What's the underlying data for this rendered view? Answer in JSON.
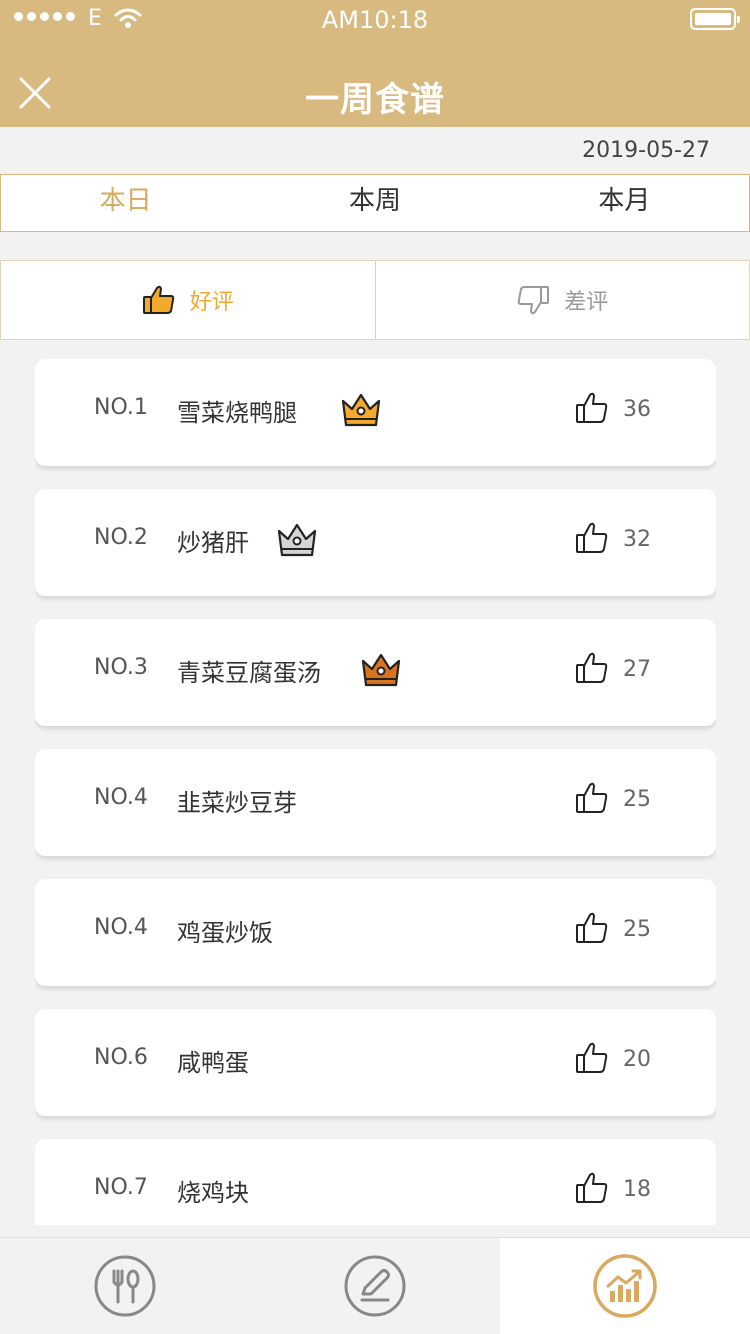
{
  "status_bar": {
    "carrier": "E",
    "time": "AM10:18"
  },
  "header": {
    "title": "一周食谱"
  },
  "date": "2019-05-27",
  "period_tabs": [
    {
      "label": "本日",
      "active": true
    },
    {
      "label": "本周",
      "active": false
    },
    {
      "label": "本月",
      "active": false
    }
  ],
  "rating_tabs": {
    "good": {
      "label": "好评",
      "icon": "thumbs-up-icon",
      "active": true
    },
    "bad": {
      "label": "差评",
      "icon": "thumbs-down-icon",
      "active": false
    }
  },
  "dishes": [
    {
      "rank": "NO.1",
      "name": "雪菜烧鸭腿",
      "crown": "gold",
      "likes": "36"
    },
    {
      "rank": "NO.2",
      "name": "炒猪肝",
      "crown": "silver",
      "likes": "32"
    },
    {
      "rank": "NO.3",
      "name": "青菜豆腐蛋汤",
      "crown": "bronze",
      "likes": "27"
    },
    {
      "rank": "NO.4",
      "name": "韭菜炒豆芽",
      "crown": null,
      "likes": "25"
    },
    {
      "rank": "NO.4",
      "name": "鸡蛋炒饭",
      "crown": null,
      "likes": "25"
    },
    {
      "rank": "NO.6",
      "name": "咸鸭蛋",
      "crown": null,
      "likes": "20"
    },
    {
      "rank": "NO.7",
      "name": "烧鸡块",
      "crown": null,
      "likes": "18"
    }
  ],
  "bottom_nav": [
    {
      "icon": "fork-knife-icon",
      "active": false
    },
    {
      "icon": "edit-icon",
      "active": false
    },
    {
      "icon": "chart-icon",
      "active": true
    }
  ],
  "colors": {
    "brand": "#d8b97f",
    "accent": "#d8a95e",
    "good": "#f2a92c",
    "crown_gold": "#f2a92c",
    "crown_silver": "#d4d4d4",
    "crown_bronze": "#d9731f"
  }
}
